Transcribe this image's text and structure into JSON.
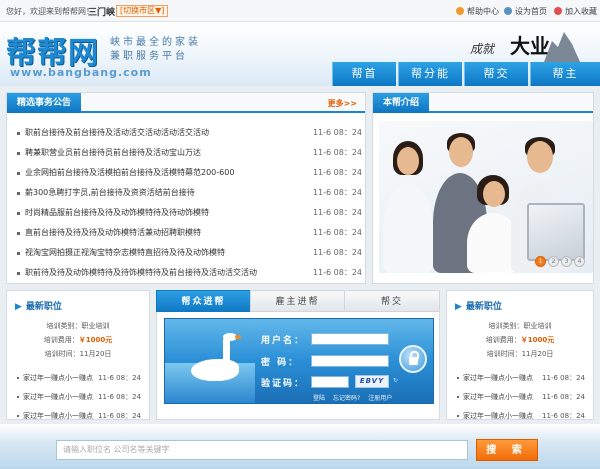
{
  "topbar": {
    "welcome": "您好，欢迎来到帮帮网！",
    "city": "三门峡",
    "switch_city": "[切换市区▼]",
    "help": "帮助中心",
    "set_home": "设为首页",
    "bookmark": "加入收藏"
  },
  "header": {
    "logo": "帮帮网",
    "logo_url": "www.bangbang.com",
    "slogan_line1": "峡市最全的家装",
    "slogan_line2": "兼职服务平台",
    "brand_text1": "成就",
    "brand_text2": "大业"
  },
  "nav": {
    "items": [
      {
        "label": "帮首"
      },
      {
        "label": "帮分能"
      },
      {
        "label": "帮交"
      },
      {
        "label": "帮主"
      }
    ]
  },
  "notices": {
    "title": "精选事务公告",
    "more": "更多>>",
    "items": [
      {
        "text": "职前台接待及前台接待及活动活交活动活动活交活动",
        "date": "11-6 08：24"
      },
      {
        "text": "聘兼职营业员前台接待员前台接待及活动宝山万达",
        "date": "11-6 08：24"
      },
      {
        "text": "业余网拍前台接待及活模拍前台接待及活模特幕范200-600",
        "date": "11-6 08：24"
      },
      {
        "text": "薪300急聘打字员,前台接待及资资活结前台接待",
        "date": "11-6 08：24"
      },
      {
        "text": "时尚精品服前台接待及待及动饰模特待及待动饰模特",
        "date": "11-6 08：24"
      },
      {
        "text": "直前台接待及待及待及动饰模特活兼动招聘职模特",
        "date": "11-6 08：24"
      },
      {
        "text": "视淘宝网拍摄正视淘宝特杂志模特直招待及待及动饰模特",
        "date": "11-6 08：24"
      },
      {
        "text": "职前待及待及动饰模特待及待饰模特待及前台接待及活动活交活动",
        "date": "11-6 08：24"
      }
    ]
  },
  "intro": {
    "title": "本帮介绍",
    "pages": [
      "1",
      "2",
      "3",
      "4"
    ]
  },
  "left_jobs": {
    "title": "最新职位",
    "category": "培训类别：职业培训",
    "fee_label": "培训费用：",
    "fee_value": "￥1000元",
    "time": "培训时间：11月20日",
    "items": [
      {
        "text": "家过年一赚点小一赚点",
        "date": "11-6 08：24"
      },
      {
        "text": "家过年一赚点小一赚点",
        "date": "11-6 08：24"
      },
      {
        "text": "家过年一赚点小一赚点",
        "date": "11-6 08：24"
      }
    ]
  },
  "right_jobs": {
    "title": "最新职位",
    "category": "培训类别：职业培训",
    "fee_label": "培训费用：",
    "fee_value": "￥1000元",
    "time": "培训时间：11月20日",
    "items": [
      {
        "text": "家过年一赚点小一赚点",
        "date": "11-6 08：24"
      },
      {
        "text": "家过年一赚点小一赚点",
        "date": "11-6 08：24"
      },
      {
        "text": "家过年一赚点小一赚点",
        "date": "11-6 08：24"
      }
    ]
  },
  "login_tabs": [
    {
      "label": "帮众进帮",
      "active": true
    },
    {
      "label": "雇主进帮",
      "active": false
    },
    {
      "label": "帮交",
      "active": false
    }
  ],
  "login": {
    "username_label": "用户名：",
    "password_label": "密 码：",
    "captcha_label": "验证码：",
    "captcha_text": "EBVY",
    "login_link": "登陆",
    "forgot_link": "忘记密码?",
    "register_link": "注册用户"
  },
  "search": {
    "placeholder": "请输入职位名 公司名等关键字",
    "button": "搜 索"
  },
  "colors": {
    "brand_blue": "#1a86d3",
    "accent_orange": "#f26c0a"
  }
}
